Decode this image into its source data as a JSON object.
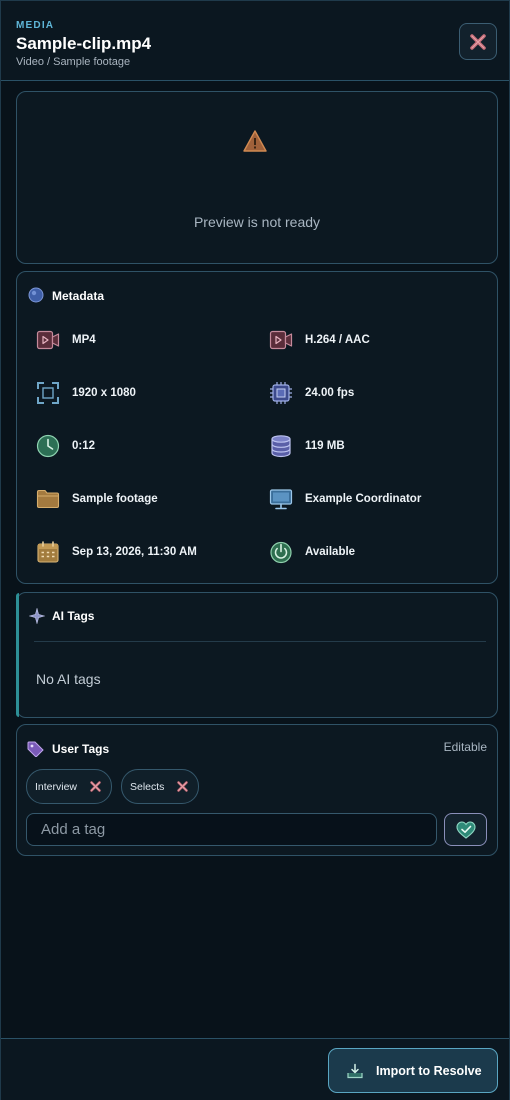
{
  "header": {
    "eyebrow": "MEDIA",
    "title": "Sample-clip.mp4",
    "subtitle": "Video / Sample footage",
    "close_icon": "close-icon"
  },
  "preview": {
    "icon": "warning-icon",
    "status_text": "Preview is not ready"
  },
  "metadata": {
    "title": "Metadata",
    "icon": "globe-icon",
    "items": [
      {
        "icon": "video-file-icon",
        "value": "MP4"
      },
      {
        "icon": "video-file-icon",
        "value": "H.264 / AAC"
      },
      {
        "icon": "resolution-frame-icon",
        "value": "1920 x 1080"
      },
      {
        "icon": "cpu-chip-icon",
        "value": "24.00 fps"
      },
      {
        "icon": "clock-icon",
        "value": "0:12"
      },
      {
        "icon": "database-icon",
        "value": "119 MB"
      },
      {
        "icon": "folder-icon",
        "value": "Sample footage"
      },
      {
        "icon": "monitor-icon",
        "value": "Example Coordinator"
      },
      {
        "icon": "calendar-icon",
        "value": "Sep 13, 2026, 11:30 AM"
      },
      {
        "icon": "power-icon",
        "value": "Available"
      }
    ]
  },
  "ai_tags": {
    "title": "AI Tags",
    "icon": "sparkle-icon",
    "empty_text": "No AI tags",
    "accent_color": "#2d8f96"
  },
  "user_tags": {
    "title": "User Tags",
    "icon": "tag-icon",
    "editable_label": "Editable",
    "tags": [
      {
        "label": "Interview",
        "remove_icon": "remove-icon"
      },
      {
        "label": "Selects",
        "remove_icon": "remove-icon"
      }
    ],
    "input_placeholder": "Add a tag",
    "add_icon": "heart-add-icon"
  },
  "footer": {
    "import_label": "Import to Resolve",
    "import_icon": "import-tray-icon"
  },
  "colors": {
    "background": "#08121a",
    "accent": "#5fb6d8",
    "border": "#2f5266"
  }
}
